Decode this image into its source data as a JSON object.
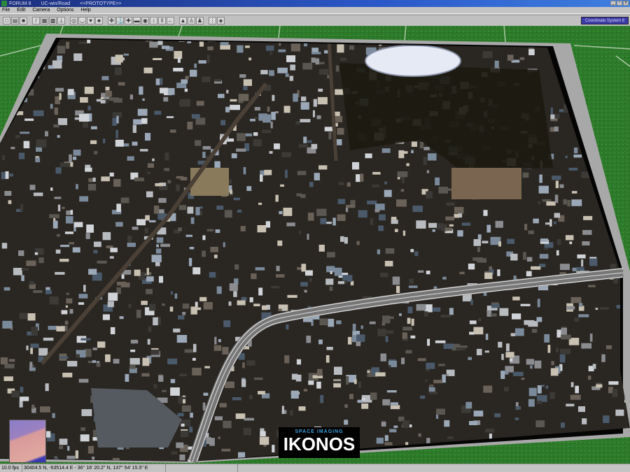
{
  "titlebar": {
    "app": "FORUM 8",
    "product": "UC-win/Road",
    "mode": "<<PROTOTYPE>>",
    "minimize": "_",
    "restore": "▫",
    "close": "x"
  },
  "menu": [
    "File",
    "Edit",
    "Camera",
    "Options",
    "Help"
  ],
  "toolbar": [
    {
      "name": "new-icon",
      "glyph": "□"
    },
    {
      "name": "open-icon",
      "glyph": "▤"
    },
    {
      "name": "save-icon",
      "glyph": "■"
    },
    null,
    {
      "name": "road-draw-icon",
      "glyph": "/"
    },
    {
      "name": "terrain-icon",
      "glyph": "▦"
    },
    {
      "name": "texture-icon",
      "glyph": "▩"
    },
    {
      "name": "structure-icon",
      "glyph": "⊥"
    },
    null,
    {
      "name": "model-icon",
      "glyph": "◎"
    },
    {
      "name": "bowl-icon",
      "glyph": "◡"
    },
    {
      "name": "tree-icon",
      "glyph": "♥"
    },
    {
      "name": "plant-icon",
      "glyph": "♣"
    },
    null,
    {
      "name": "rotate-icon",
      "glyph": "✥"
    },
    {
      "name": "anchor-icon",
      "glyph": "⚓"
    },
    {
      "name": "move-icon",
      "glyph": "✚"
    },
    {
      "name": "car-icon",
      "glyph": "▬"
    },
    {
      "name": "globe-icon",
      "glyph": "◉"
    },
    {
      "name": "up-down-icon",
      "glyph": "↕"
    },
    {
      "name": "pause-icon",
      "glyph": "‖"
    },
    {
      "name": "back-icon",
      "glyph": "←"
    },
    null,
    {
      "name": "landscape-icon",
      "glyph": "▲"
    },
    {
      "name": "driver-icon",
      "glyph": "♙"
    },
    {
      "name": "walk-icon",
      "glyph": "♟"
    },
    null,
    {
      "name": "grid-icon",
      "glyph": "⋮"
    },
    {
      "name": "eye-icon",
      "glyph": "◈"
    }
  ],
  "coordinate_system": "Coordinate System 8",
  "logo": {
    "top": "SPACE IMAGING",
    "main": "IKONOS"
  },
  "image_label": "IKONOS",
  "status": {
    "fps": "10.0 fps",
    "position": "30404.5 N, -53514.4 E  -  36° 16' 20.2\" N, 137° 54' 15.5\" E",
    "field3": "",
    "field4": ""
  }
}
